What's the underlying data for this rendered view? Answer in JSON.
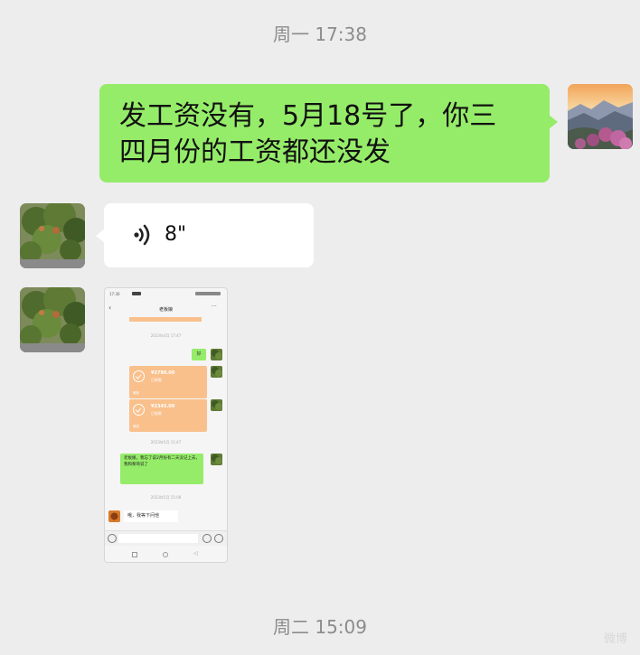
{
  "timestamps": {
    "first": "周一 17:38",
    "second": "周二 15:09"
  },
  "sent_message": {
    "line1": "发工资没有，5月18号了，你三",
    "line2": "四月份的工资都还没发"
  },
  "voice_message": {
    "duration": "8\""
  },
  "embedded_screenshot": {
    "status_time": "17:30",
    "contact_name": "老板娘",
    "time1": "2023年4月 17:47",
    "reply_ok": "好",
    "transfer1": {
      "amount": "¥2790.00",
      "status": "已收款",
      "label": "微信"
    },
    "transfer2": {
      "amount": "¥2345.00",
      "status": "已收款",
      "label": "微信"
    },
    "time2": "2023年5月 11:47",
    "long_msg": "老板娘，我忘了说2月份有二天没记上去，我和黎哥说了",
    "time3": "2023年5月 15:08",
    "reply_last": "哦，我等下问他"
  },
  "watermark": "微博",
  "colors": {
    "bg": "#ededed",
    "sent_bubble": "#95ec69",
    "received_bubble": "#ffffff",
    "transfer": "#f9c08c",
    "timestamp": "#8c8c8c"
  }
}
